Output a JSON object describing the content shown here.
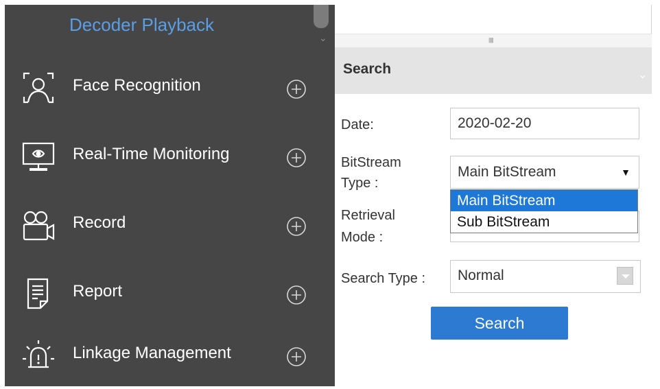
{
  "sidebar": {
    "top_item": "Decoder Playback",
    "items": [
      {
        "label": "Face Recognition",
        "icon": "face-recognition-icon"
      },
      {
        "label": "Real-Time Monitoring",
        "icon": "monitor-icon"
      },
      {
        "label": "Record",
        "icon": "camera-icon"
      },
      {
        "label": "Report",
        "icon": "report-icon"
      },
      {
        "label": "Linkage Management",
        "icon": "alarm-icon"
      }
    ],
    "expand_icon": "plus-circle-icon"
  },
  "search": {
    "title": "Search",
    "date_label": "Date:",
    "date_value": "2020-02-20",
    "bitstream_label_line1": "BitStream",
    "bitstream_label_line2": "Type :",
    "bitstream_value": "Main BitStream",
    "bitstream_options": [
      "Main BitStream",
      "Sub BitStream"
    ],
    "retrieval_label_line1": "Retrieval",
    "retrieval_label_line2": "Mode :",
    "search_type_label": "Search Type :",
    "search_type_value": "Normal",
    "search_button": "Search"
  },
  "colors": {
    "sidebar_bg": "#464646",
    "accent_link": "#5a9ee6",
    "button_blue": "#2d7ad2",
    "dropdown_selected": "#1e78d8"
  }
}
